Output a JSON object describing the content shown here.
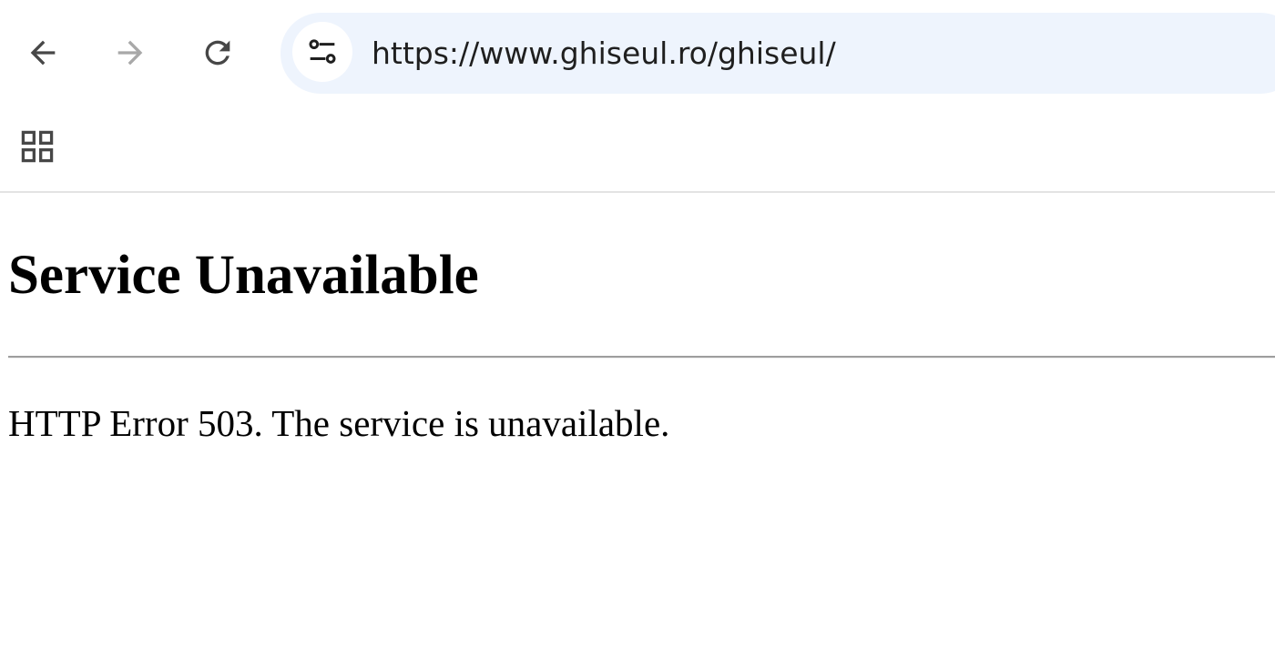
{
  "browser": {
    "url": "https://www.ghiseul.ro/ghiseul/",
    "icons": {
      "back": "arrow-left-icon",
      "forward": "arrow-right-icon",
      "reload": "reload-icon",
      "site_info": "tune-icon",
      "apps": "apps-grid-icon"
    },
    "colors": {
      "omnibox_bg": "#eef4fd",
      "icon_active": "#474747",
      "icon_disabled": "#a8a8a8"
    }
  },
  "page": {
    "title": "Service Unavailable",
    "message": "HTTP Error 503. The service is unavailable."
  }
}
